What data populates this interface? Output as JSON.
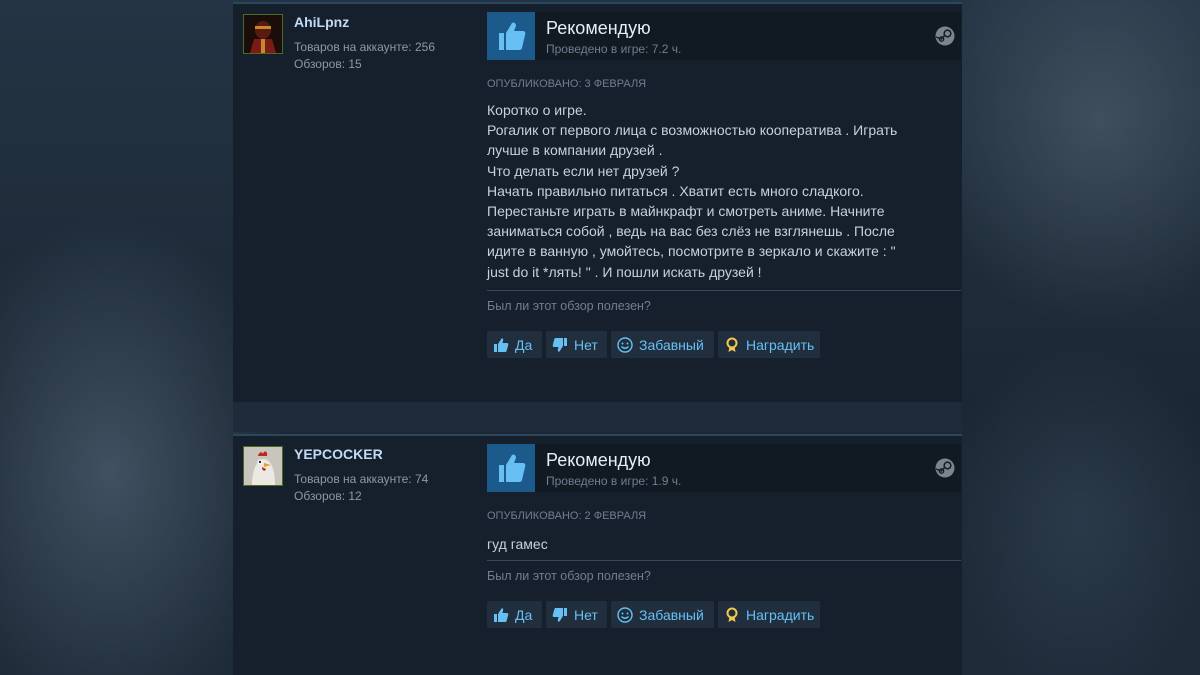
{
  "helpful_question": "Был ли этот обзор полезен?",
  "buttons": {
    "yes": "Да",
    "no": "Нет",
    "funny": "Забавный",
    "award": "Наградить"
  },
  "reviews": [
    {
      "author": "AhiLpnz",
      "products": "Товаров на аккаунте: 256",
      "reviews_count": "Обзоров: 15",
      "verdict": "Рекомендую",
      "hours": "Проведено в игре: 7.2 ч.",
      "posted": "ОПУБЛИКОВАНО: 3 ФЕВРАЛЯ",
      "lines": [
        "Коротко о игре.",
        "Рогалик от первого лица с возможностью кооператива . Играть",
        "лучше в компании друзей .",
        "Что делать если нет друзей ?",
        "Начать правильно питаться . Хватит есть много сладкого.",
        "Перестаньте играть в майнкрафт и смотреть аниме. Начните",
        "заниматься собой , ведь на вас без слёз не взглянешь . После",
        "идите в ванную , умойтесь, посмотрите в зеркало и скажите : \"",
        "just do it *лять! \" . И пошли искать друзей !"
      ]
    },
    {
      "author": "YEPCOCKER",
      "products": "Товаров на аккаунте: 74",
      "reviews_count": "Обзоров: 12",
      "verdict": "Рекомендую",
      "hours": "Проведено в игре: 1.9 ч.",
      "posted": "ОПУБЛИКОВАНО: 2 ФЕВРАЛЯ",
      "lines": [
        "гуд гамес"
      ]
    }
  ]
}
